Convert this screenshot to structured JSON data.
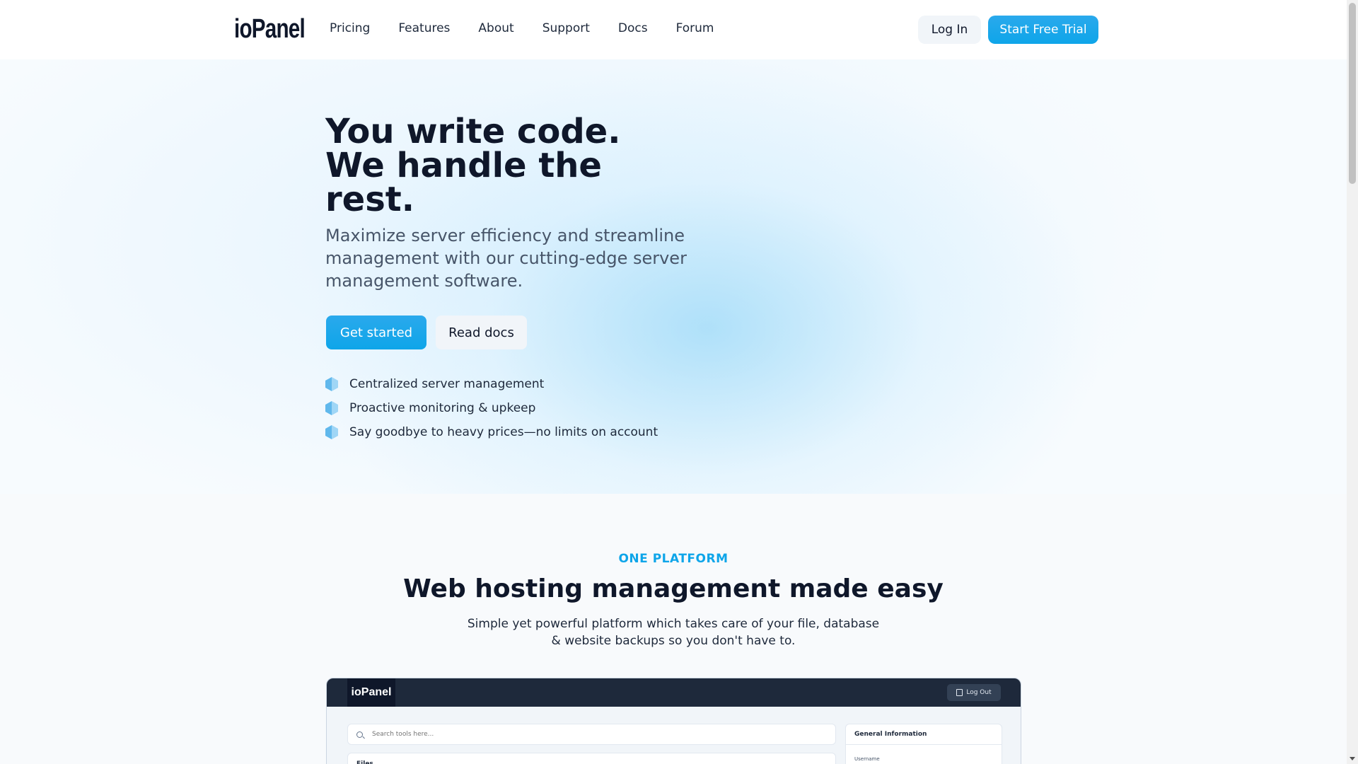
{
  "header": {
    "logo": "ioPanel",
    "nav": [
      "Pricing",
      "Features",
      "About",
      "Support",
      "Docs",
      "Forum"
    ],
    "login_label": "Log In",
    "trial_label": "Start Free Trial"
  },
  "hero": {
    "title_lines": [
      "You write code.",
      "We handle the",
      "rest."
    ],
    "subtitle": "Maximize server efficiency and streamline management with our cutting-edge server management software.",
    "primary_label": "Get started",
    "secondary_label": "Read docs",
    "features": [
      {
        "icon": "cube-icon",
        "text": "Centralized server management"
      },
      {
        "icon": "cube-icon",
        "text": "Proactive monitoring & upkeep"
      },
      {
        "icon": "cube-icon",
        "text": "Say goodbye to heavy prices—no limits on account"
      }
    ],
    "accent_color": "#0ea5e9"
  },
  "platform": {
    "eyebrow": "ONE PLATFORM",
    "title": "Web hosting management made easy",
    "subtitle": "Simple yet powerful platform which takes care of your file, database & website backups so you don't have to."
  },
  "preview": {
    "logo": "ioPanel",
    "logout_label": "Log Out",
    "search_placeholder": "Search tools here...",
    "files_title": "Files",
    "info_title": "General Information",
    "info_label": "Username"
  }
}
